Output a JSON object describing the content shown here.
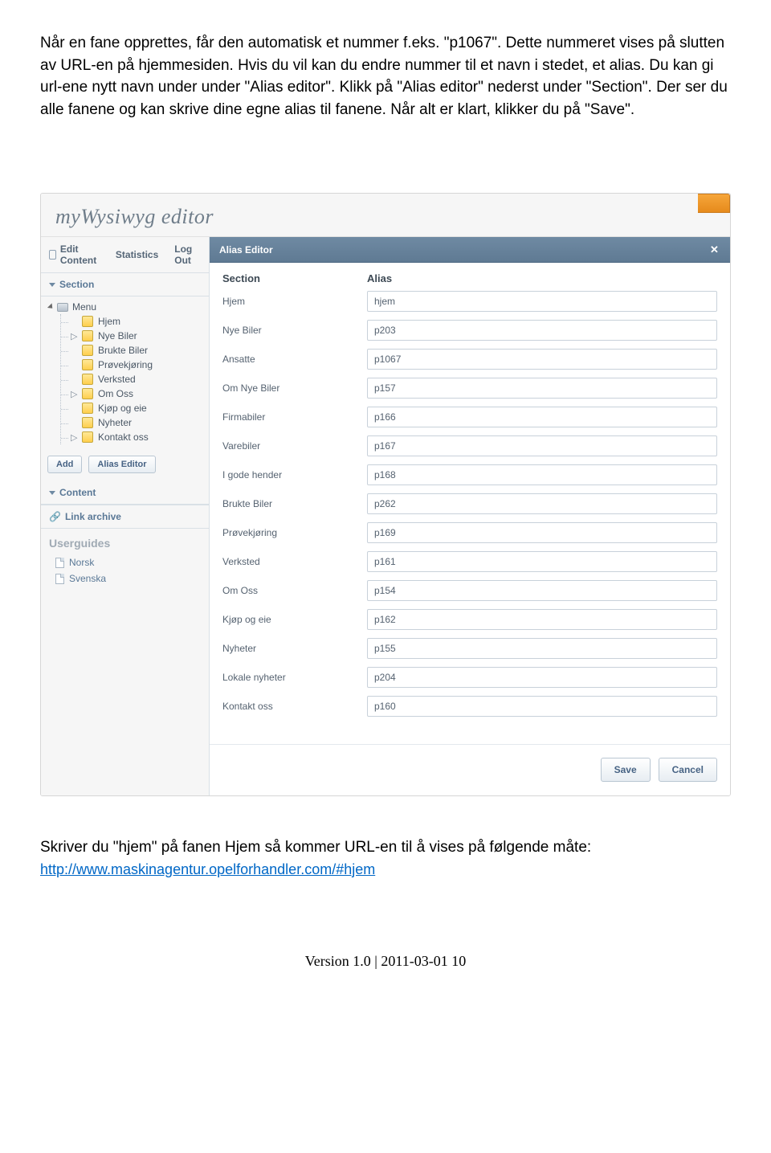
{
  "intro_text": "Når en fane opprettes, får den automatisk et nummer f.eks. \"p1067\". Dette nummeret vises på slutten av URL-en på hjemmesiden. Hvis du vil kan du endre nummer til et navn i stedet, et alias. Du kan gi url-ene nytt navn under under \"Alias editor\". Klikk på \"Alias editor\" nederst under \"Section\". Der ser du alle fanene og kan skrive dine egne alias til fanene. Når alt er klart, klikker du på \"Save\".",
  "app_title": "myWysiwyg editor",
  "tabs": {
    "edit": "Edit Content",
    "stats": "Statistics",
    "logout": "Log Out"
  },
  "panel": {
    "section": "Section",
    "content": "Content",
    "link_archive": "Link archive"
  },
  "tree": {
    "root": "Menu",
    "items": [
      {
        "label": "Hjem",
        "expander": ""
      },
      {
        "label": "Nye Biler",
        "expander": "▷"
      },
      {
        "label": "Brukte Biler",
        "expander": ""
      },
      {
        "label": "Prøvekjøring",
        "expander": ""
      },
      {
        "label": "Verksted",
        "expander": ""
      },
      {
        "label": "Om Oss",
        "expander": "▷"
      },
      {
        "label": "Kjøp og eie",
        "expander": ""
      },
      {
        "label": "Nyheter",
        "expander": ""
      },
      {
        "label": "Kontakt oss",
        "expander": "▷"
      }
    ]
  },
  "buttons": {
    "add": "Add",
    "alias_editor": "Alias Editor"
  },
  "guides": {
    "title": "Userguides",
    "items": [
      "Norsk",
      "Svenska"
    ]
  },
  "modal_title": "Alias Editor",
  "cols": {
    "section": "Section",
    "alias": "Alias"
  },
  "rows": [
    {
      "section": "Hjem",
      "alias": "hjem"
    },
    {
      "section": "Nye Biler",
      "alias": "p203"
    },
    {
      "section": "Ansatte",
      "alias": "p1067"
    },
    {
      "section": "Om Nye Biler",
      "alias": "p157"
    },
    {
      "section": "Firmabiler",
      "alias": "p166"
    },
    {
      "section": "Varebiler",
      "alias": "p167"
    },
    {
      "section": "I gode hender",
      "alias": "p168"
    },
    {
      "section": "Brukte Biler",
      "alias": "p262"
    },
    {
      "section": "Prøvekjøring",
      "alias": "p169"
    },
    {
      "section": "Verksted",
      "alias": "p161"
    },
    {
      "section": "Om Oss",
      "alias": "p154"
    },
    {
      "section": "Kjøp og eie",
      "alias": "p162"
    },
    {
      "section": "Nyheter",
      "alias": "p155"
    },
    {
      "section": "Lokale nyheter",
      "alias": "p204"
    },
    {
      "section": "Kontakt oss",
      "alias": "p160"
    }
  ],
  "actions": {
    "save": "Save",
    "cancel": "Cancel"
  },
  "outro_text": "Skriver du \"hjem\" på fanen Hjem så kommer URL-en til å vises på følgende måte:",
  "outro_link": "http://www.maskinagentur.opelforhandler.com/#hjem",
  "footer": "Version 1.0 | 2011-03-01 10"
}
